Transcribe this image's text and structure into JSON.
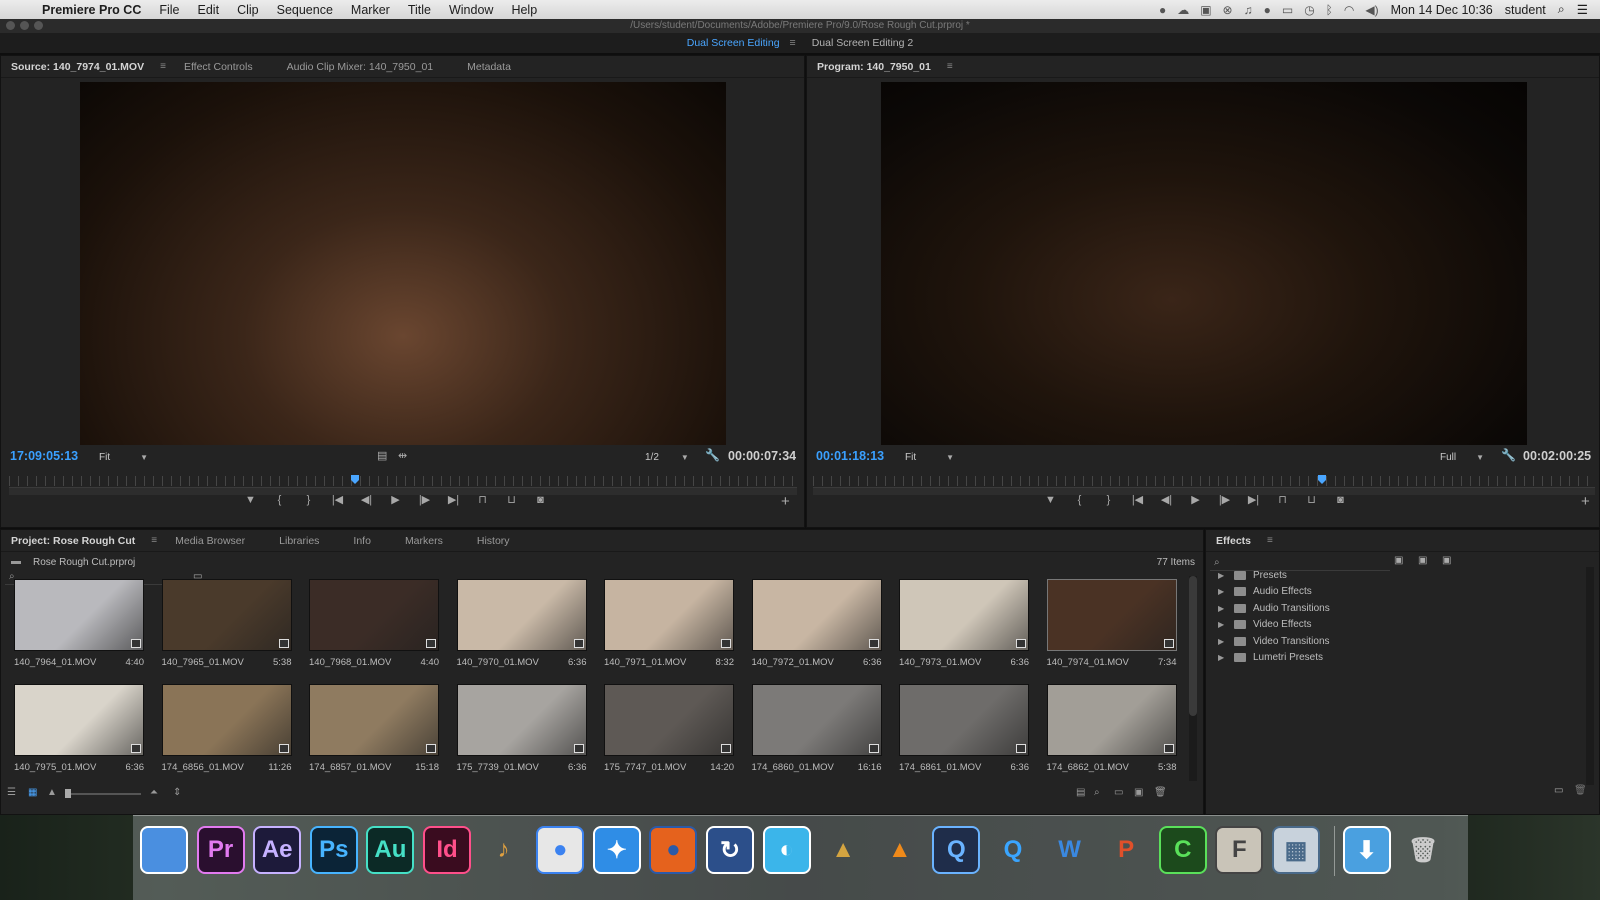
{
  "menubar": {
    "app_name": "Premiere Pro CC",
    "menus": [
      "File",
      "Edit",
      "Clip",
      "Sequence",
      "Marker",
      "Title",
      "Window",
      "Help"
    ],
    "clock": "Mon 14 Dec  10:36",
    "user": "student"
  },
  "window": {
    "title": "/Users/student/Documents/Adobe/Premiere Pro/9.0/Rose Rough Cut.prproj *"
  },
  "workspaces": {
    "active": "Dual Screen Editing",
    "other": "Dual Screen Editing 2"
  },
  "source_monitor": {
    "tabs": [
      "Source: 140_7974_01.MOV",
      "Effect Controls",
      "Audio Clip Mixer: 140_7950_01",
      "Metadata"
    ],
    "timecode": "17:09:05:13",
    "zoom": "Fit",
    "resolution": "1/2",
    "duration": "00:00:07:34"
  },
  "program_monitor": {
    "tab": "Program: 140_7950_01",
    "timecode": "00:01:18:13",
    "zoom": "Fit",
    "resolution": "Full",
    "duration": "00:02:00:25"
  },
  "project_panel": {
    "tabs": [
      "Project: Rose Rough Cut",
      "Media Browser",
      "Libraries",
      "Info",
      "Markers",
      "History"
    ],
    "project_file": "Rose Rough Cut.prproj",
    "item_count": "77 Items",
    "clips": [
      {
        "name": "140_7964_01.MOV",
        "duration": "4:40",
        "color": "#b9b9bd"
      },
      {
        "name": "140_7965_01.MOV",
        "duration": "5:38",
        "color": "#4a3a2b"
      },
      {
        "name": "140_7968_01.MOV",
        "duration": "4:40",
        "color": "#3b2c26"
      },
      {
        "name": "140_7970_01.MOV",
        "duration": "6:36",
        "color": "#c9b9a7"
      },
      {
        "name": "140_7971_01.MOV",
        "duration": "8:32",
        "color": "#c6b4a1"
      },
      {
        "name": "140_7972_01.MOV",
        "duration": "6:36",
        "color": "#c8b6a3"
      },
      {
        "name": "140_7973_01.MOV",
        "duration": "6:36",
        "color": "#cfc6b8"
      },
      {
        "name": "140_7974_01.MOV",
        "duration": "7:34",
        "color": "#4a3224"
      },
      {
        "name": "140_7975_01.MOV",
        "duration": "6:36",
        "color": "#d9d4ca"
      },
      {
        "name": "174_6856_01.MOV",
        "duration": "11:26",
        "color": "#8a7457"
      },
      {
        "name": "174_6857_01.MOV",
        "duration": "15:18",
        "color": "#8f7b60"
      },
      {
        "name": "175_7739_01.MOV",
        "duration": "6:36",
        "color": "#a7a4a0"
      },
      {
        "name": "175_7747_01.MOV",
        "duration": "14:20",
        "color": "#5e5955"
      },
      {
        "name": "174_6860_01.MOV",
        "duration": "16:16",
        "color": "#7c7a78"
      },
      {
        "name": "174_6861_01.MOV",
        "duration": "6:36",
        "color": "#6e6c6a"
      },
      {
        "name": "174_6862_01.MOV",
        "duration": "5:38",
        "color": "#a29e97"
      }
    ]
  },
  "effects_panel": {
    "title": "Effects",
    "items": [
      "Presets",
      "Audio Effects",
      "Audio Transitions",
      "Video Effects",
      "Video Transitions",
      "Lumetri Presets"
    ]
  },
  "dock": {
    "apps": [
      {
        "label": "",
        "icon": "finder-icon",
        "bg": "#4a8fe0",
        "fg": "#fff"
      },
      {
        "label": "Pr",
        "icon": "premiere-icon",
        "bg": "#2a0f2f",
        "fg": "#e27af0"
      },
      {
        "label": "Ae",
        "icon": "after-effects-icon",
        "bg": "#1d1a3a",
        "fg": "#c6b1ff"
      },
      {
        "label": "Ps",
        "icon": "photoshop-icon",
        "bg": "#0b2437",
        "fg": "#47b4ff"
      },
      {
        "label": "Au",
        "icon": "audition-icon",
        "bg": "#0c2a26",
        "fg": "#45e0c6"
      },
      {
        "label": "Id",
        "icon": "indesign-icon",
        "bg": "#3a0c1f",
        "fg": "#ff4f8a"
      },
      {
        "label": "♪",
        "icon": "garageband-icon",
        "bg": "transparent",
        "fg": "#e0a040"
      },
      {
        "label": "●",
        "icon": "chrome-icon",
        "bg": "#e7e7e7",
        "fg": "#3b82f0"
      },
      {
        "label": "✦",
        "icon": "safari-icon",
        "bg": "#2f8de6",
        "fg": "#fff"
      },
      {
        "label": "●",
        "icon": "firefox-icon",
        "bg": "#e5621d",
        "fg": "#2b5aa8"
      },
      {
        "label": "↻",
        "icon": "backup-icon",
        "bg": "#2c4f8a",
        "fg": "#fff"
      },
      {
        "label": "◐",
        "icon": "network-icon",
        "bg": "#3bb5ea",
        "fg": "#fff"
      },
      {
        "label": "▲",
        "icon": "cocktail-icon",
        "bg": "transparent",
        "fg": "#d4a440"
      },
      {
        "label": "▲",
        "icon": "vlc-icon",
        "bg": "transparent",
        "fg": "#f08a1a"
      },
      {
        "label": "Q",
        "icon": "quicktime-icon",
        "bg": "#1f2d4a",
        "fg": "#6ab3ff"
      },
      {
        "label": "Q",
        "icon": "quicktime-x-icon",
        "bg": "transparent",
        "fg": "#3aa5ff"
      },
      {
        "label": "W",
        "icon": "word-icon",
        "bg": "transparent",
        "fg": "#3a88e0"
      },
      {
        "label": "P",
        "icon": "powerpoint-icon",
        "bg": "transparent",
        "fg": "#e0502a"
      },
      {
        "label": "C",
        "icon": "camtasia-icon",
        "bg": "#1c4a1c",
        "fg": "#5ae05a"
      },
      {
        "label": "F",
        "icon": "font-book-icon",
        "bg": "#c9c4b8",
        "fg": "#444"
      },
      {
        "label": "▦",
        "icon": "preview-icon",
        "bg": "#c8d2dc",
        "fg": "#4a6a8a"
      },
      {
        "label": "⬇",
        "icon": "downloads-icon",
        "bg": "#4aa0e0",
        "fg": "#fff"
      },
      {
        "label": "🗑",
        "icon": "trash-icon",
        "bg": "transparent",
        "fg": "#ccc"
      }
    ]
  }
}
